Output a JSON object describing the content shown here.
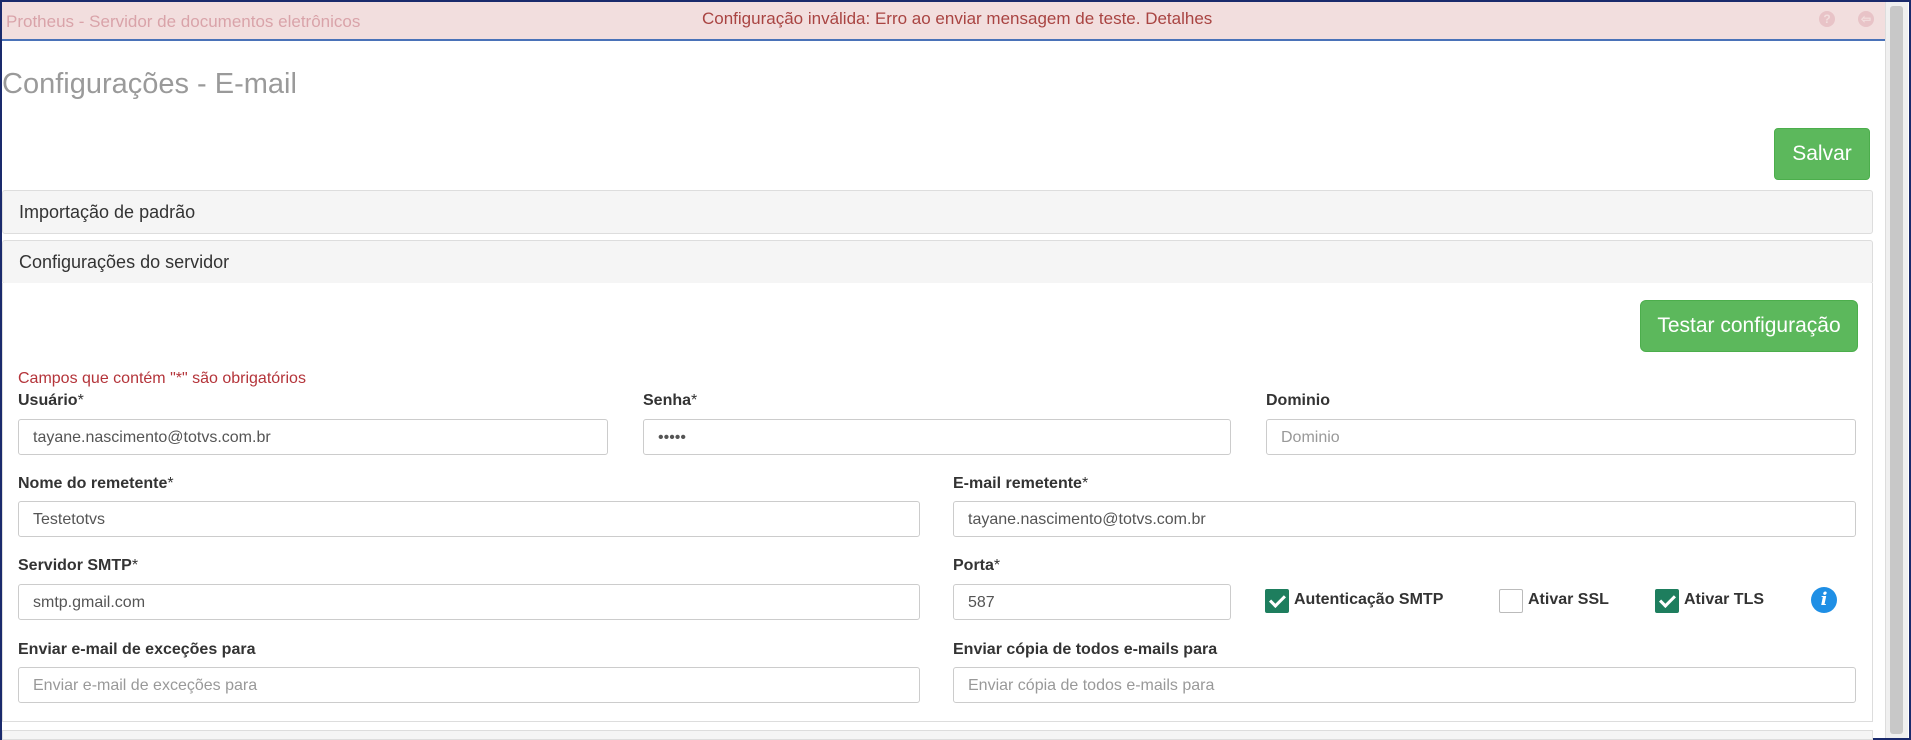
{
  "alert": {
    "background_title": "Protheus - Servidor de documentos eletrônicos",
    "message": "Configuração inválida: Erro ao enviar mensagem de teste.",
    "details_link": "Detalhes",
    "color": "#a94442"
  },
  "page": {
    "title": "Configurações - E-mail"
  },
  "toolbar": {
    "save_label": "Salvar",
    "save_color": "#5cb85c"
  },
  "panels": {
    "import_title": "Importação de padrão",
    "server_title": "Configurações do servidor"
  },
  "server": {
    "test_button": "Testar configuração",
    "required_note": "Campos que contém \"*\" são obrigatórios",
    "required_mark": "*",
    "fields": {
      "usuario": {
        "label": "Usuário",
        "value": "tayane.nascimento@totvs.com.br"
      },
      "senha": {
        "label": "Senha",
        "value": "•••••"
      },
      "dominio": {
        "label": "Dominio",
        "placeholder": "Dominio"
      },
      "nome_remetente": {
        "label": "Nome do remetente",
        "value": "Testetotvs"
      },
      "email_remetente": {
        "label": "E-mail remetente",
        "value": "tayane.nascimento@totvs.com.br"
      },
      "servidor_smtp": {
        "label": "Servidor SMTP",
        "value": "smtp.gmail.com"
      },
      "porta": {
        "label": "Porta",
        "value": "587"
      },
      "enviar_excecoes": {
        "label": "Enviar e-mail de exceções para",
        "placeholder": "Enviar e-mail de exceções para"
      },
      "enviar_copia": {
        "label": "Enviar cópia de todos e-mails para",
        "placeholder": "Enviar cópia de todos e-mails para"
      }
    },
    "checkboxes": {
      "auth_smtp": {
        "label": "Autenticação SMTP",
        "checked": true
      },
      "ssl": {
        "label": "Ativar SSL",
        "checked": false
      },
      "tls": {
        "label": "Ativar TLS",
        "checked": true
      }
    },
    "info_icon": "info-icon"
  }
}
